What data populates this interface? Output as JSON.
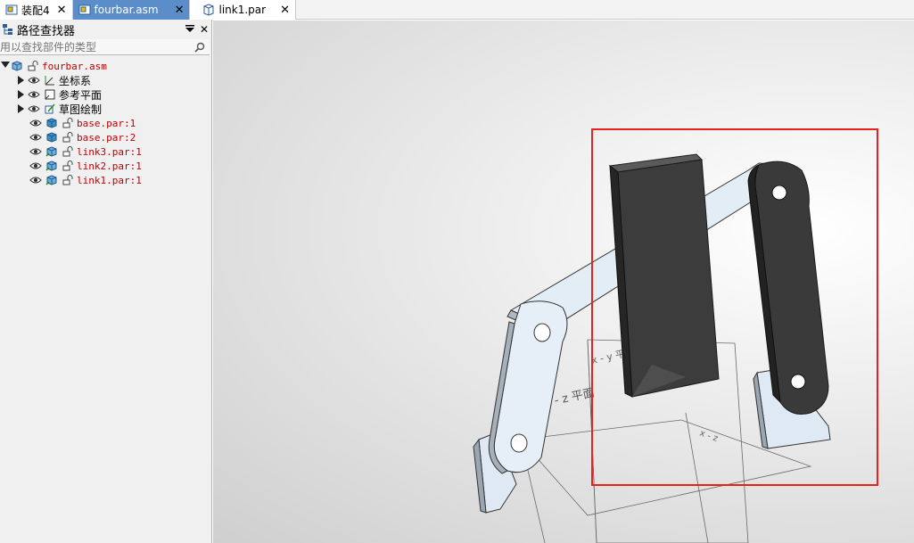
{
  "tabs": [
    {
      "label": "装配4",
      "icon": "assembly-icon",
      "active": false
    },
    {
      "label": "fourbar.asm",
      "icon": "assembly-icon",
      "active": true
    },
    {
      "label": "link1.par",
      "icon": "part-icon",
      "active": false
    }
  ],
  "close_glyph": "✕",
  "panel": {
    "title": "路径查找器",
    "search_placeholder": "用以查找部件的类型"
  },
  "tree": {
    "root": "fourbar.asm",
    "groups": [
      "坐标系",
      "参考平面",
      "草图绘制"
    ],
    "parts": [
      "base.par:1",
      "base.par:2",
      "link3.par:1",
      "link2.par:1",
      "link1.par:1"
    ]
  },
  "viewport": {
    "plane_label_1": "y - z 平面",
    "plane_label_2": "x - y 平面",
    "plane_label_3": "x - z",
    "highlight_color": "#e8211c"
  }
}
